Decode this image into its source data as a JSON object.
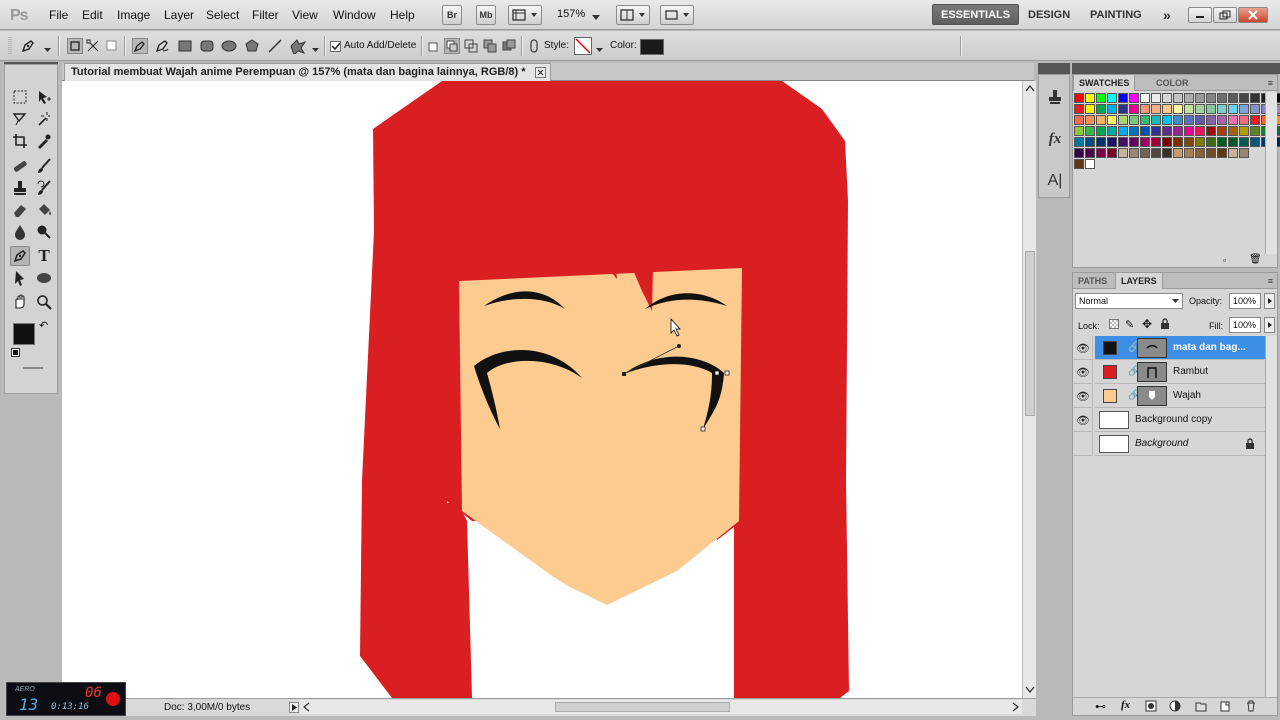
{
  "app": {
    "logo": "Ps"
  },
  "menu": [
    "File",
    "Edit",
    "Image",
    "Layer",
    "Select",
    "Filter",
    "View",
    "Window",
    "Help"
  ],
  "menubar_buttons": {
    "bridge": "Br",
    "mini_bridge": "Mb",
    "zoom": "157%"
  },
  "workspaces": {
    "active": "ESSENTIALS",
    "design": "DESIGN",
    "painting": "PAINTING"
  },
  "options_bar": {
    "auto_add_delete_label": "Auto Add/Delete",
    "auto_add_delete_checked": true,
    "style_label": "Style:",
    "color_label": "Color:",
    "color_value": "#1a1a1a"
  },
  "document": {
    "tab_title": "Tutorial membuat Wajah anime Perempuan @ 157% (mata dan bagina lainnya, RGB/8) *",
    "status_text": "Doc: 3,00M/0 bytes",
    "colors": {
      "hair": "#d91f22",
      "face": "#fccb90",
      "line": "#111111"
    }
  },
  "recorder": {
    "label": "AERO",
    "counter_a": "13",
    "counter_b": "06",
    "time": "0:13:16"
  },
  "swatches_panel": {
    "tabs": [
      "SWATCHES",
      "COLOR"
    ],
    "rows": [
      [
        "#ff0000",
        "#ffff00",
        "#00ff00",
        "#00ffff",
        "#0000ff",
        "#ff00ff",
        "#ffffff",
        "#ebebeb",
        "#d6d6d6",
        "#c2c2c2",
        "#adadad",
        "#999999",
        "#858585",
        "#707070",
        "#5c5c5c",
        "#474747",
        "#333333",
        "#1f1f1f",
        "#0a0a0a",
        "#ff1a1a"
      ],
      [
        "#ed1c24",
        "#fff200",
        "#00a651",
        "#00aeef",
        "#2e3192",
        "#ec008c",
        "#f7977a",
        "#f9ad81",
        "#fdc68a",
        "#fff79a",
        "#c4df9b",
        "#a3d39c",
        "#82ca9d",
        "#7bcdc8",
        "#6ecff6",
        "#7ea7d8",
        "#8493ca",
        "#8882be",
        "#a187be",
        "#f49ac2"
      ],
      [
        "#f26c4f",
        "#f68e55",
        "#fbaf5c",
        "#fff467",
        "#acd372",
        "#7cc576",
        "#3bb878",
        "#1abbb4",
        "#00bff3",
        "#438cca",
        "#5574b9",
        "#605ca8",
        "#855fa8",
        "#a763a8",
        "#f06ea9",
        "#f26d7d",
        "#ed1c24",
        "#f26522",
        "#f7941d",
        "#fff200"
      ],
      [
        "#8dc73f",
        "#39b54a",
        "#00a651",
        "#00a99d",
        "#00aeef",
        "#0072bc",
        "#0054a6",
        "#2e3192",
        "#662d91",
        "#92278f",
        "#ec008c",
        "#ed145b",
        "#9e0b0f",
        "#a0410d",
        "#a36209",
        "#aba000",
        "#598527",
        "#197b30",
        "#007236",
        "#00746b"
      ],
      [
        "#0076a3",
        "#004b80",
        "#003471",
        "#1b1464",
        "#440e62",
        "#630460",
        "#9e005d",
        "#9e0039",
        "#790000",
        "#7b2e00",
        "#7d4900",
        "#827b00",
        "#406618",
        "#005e20",
        "#005826",
        "#005952",
        "#005b7f",
        "#003663",
        "#002157",
        "#0d004c"
      ],
      [
        "#32004b",
        "#4b0049",
        "#7b0046",
        "#7a0026",
        "#c7b299",
        "#998675",
        "#736357",
        "#534741",
        "#37302a",
        "#c69c6d",
        "#a67c52",
        "#8c6239",
        "#754c24",
        "#603913",
        "#c7b299",
        "#998675"
      ],
      [
        "#603913",
        "#ffffff"
      ]
    ]
  },
  "layers_panel": {
    "tabs": [
      "PATHS",
      "LAYERS"
    ],
    "blend_mode": "Normal",
    "opacity_label": "Opacity:",
    "opacity": "100%",
    "lock_label": "Lock:",
    "fill_label": "Fill:",
    "fill": "100%",
    "layers": [
      {
        "name": "mata dan bag...",
        "fill_color": "#111111",
        "selected": true
      },
      {
        "name": "Rambut",
        "fill_color": "#d91f22",
        "selected": false
      },
      {
        "name": "Wajah",
        "fill_color": "#fccb90",
        "selected": false
      }
    ],
    "bg_layers": [
      {
        "name": "Background copy",
        "visible": true
      },
      {
        "name": "Background",
        "visible": false
      }
    ]
  }
}
